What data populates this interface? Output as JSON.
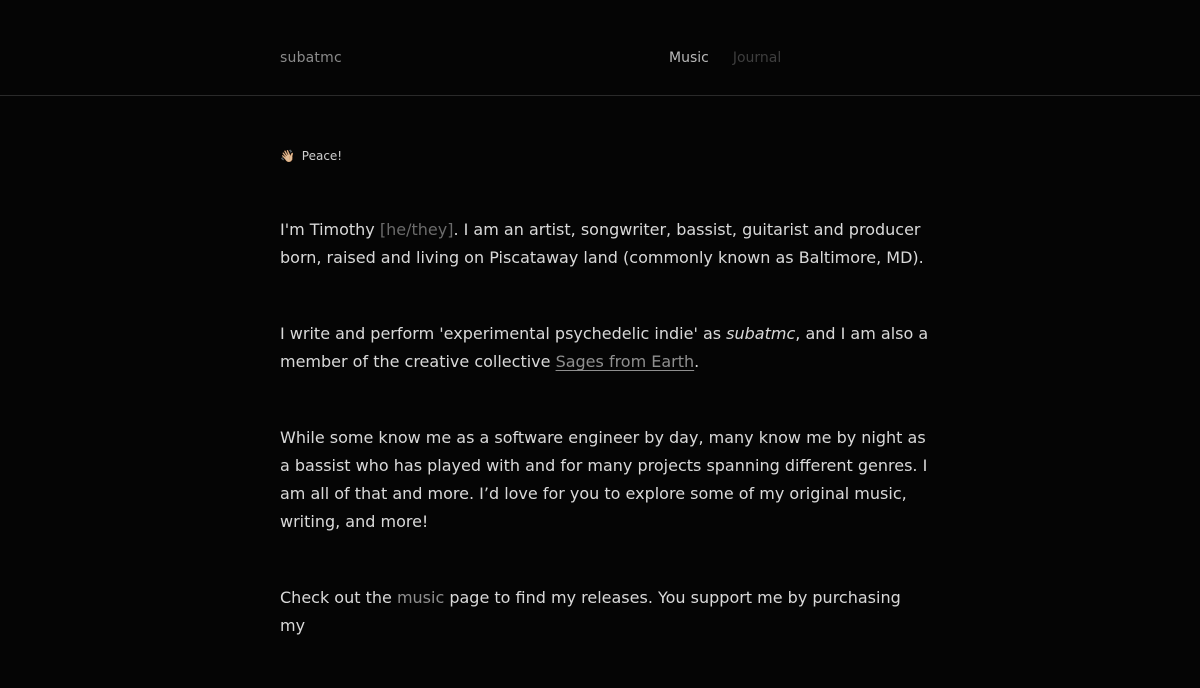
{
  "header": {
    "brand": "subatmc",
    "nav": [
      {
        "label": "Music"
      },
      {
        "label": "Journal"
      }
    ]
  },
  "content": {
    "greeting": {
      "emoji": "👋🏼",
      "text": "Peace!"
    },
    "para1": {
      "t1": "I'm Timothy ",
      "pronouns": "[he/they]",
      "t2": ". I am an artist, songwriter, bassist, guitarist and producer born, raised and living on Piscataway land (commonly known as Baltimore, MD)."
    },
    "para2": {
      "t1": "I write and perform 'experimental psychedelic indie' as ",
      "name": "subatmc",
      "t2": ", and I am also a member of the creative collective ",
      "link": "Sages from Earth",
      "t3": "."
    },
    "para3": {
      "text": "While some know me as a software engineer by day, many know me by night as a bassist who has played with and for many projects spanning different genres. I am all of that and more. I’d love for you to explore some of my original music, writing, and more!"
    },
    "para4": {
      "t1": "Check out the ",
      "link": "music",
      "t2": " page to find my releases. You support me by purchasing my"
    }
  }
}
